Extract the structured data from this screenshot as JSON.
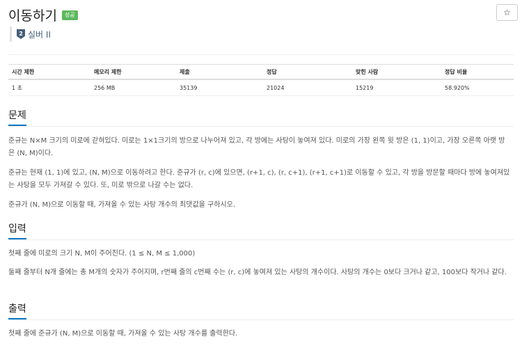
{
  "problem": {
    "title": "이동하기",
    "status_badge": "성공",
    "star": "☆",
    "tier": {
      "number": "2",
      "label": "실버 II"
    }
  },
  "stats": {
    "headers": [
      "시간 제한",
      "메모리 제한",
      "제출",
      "정답",
      "맞힌 사람",
      "정답 비율"
    ],
    "values": [
      "1 초",
      "256 MB",
      "35139",
      "21024",
      "15219",
      "58.920%"
    ]
  },
  "sections": {
    "description": {
      "title": "문제",
      "paragraphs": [
        "준규는 N×M 크기의 미로에 갇혀있다. 미로는 1×1크기의 방으로 나누어져 있고, 각 방에는 사탕이 놓여져 있다. 미로의 가장 왼쪽 윗 방은 (1, 1)이고, 가장 오른쪽 아랫 방은 (N, M)이다.",
        "준규는 현재 (1, 1)에 있고, (N, M)으로 이동하려고 한다. 준규가 (r, c)에 있으면, (r+1, c), (r, c+1), (r+1, c+1)로 이동할 수 있고, 각 방을 방문할 때마다 방에 놓여져있는 사탕을 모두 가져갈 수 있다. 또, 미로 밖으로 나갈 수는 없다.",
        "준규가 (N, M)으로 이동할 때, 가져올 수 있는 사탕 개수의 최댓값을 구하시오."
      ]
    },
    "input": {
      "title": "입력",
      "paragraphs": [
        "첫째 줄에 미로의 크기 N, M이 주어진다. (1 ≤ N, M ≤ 1,000)",
        "둘째 줄부터 N개 줄에는 총 M개의 숫자가 주어지며, r번째 줄의 c번째 수는 (r, c)에 놓여져 있는 사탕의 개수이다. 사탕의 개수는 0보다 크거나 같고, 100보다 작거나 같다."
      ]
    },
    "output": {
      "title": "출력",
      "paragraphs": [
        "첫째 줄에 준규가 (N, M)으로 이동할 때, 가져올 수 있는 사탕 개수를 출력한다."
      ]
    }
  }
}
